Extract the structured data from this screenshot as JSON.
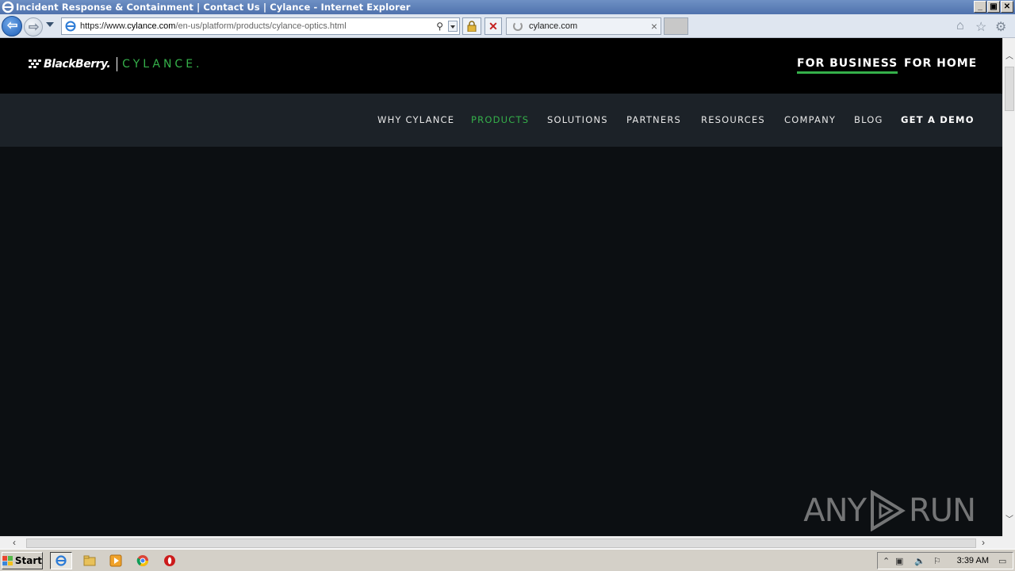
{
  "window": {
    "title": "Incident Response & Containment | Contact Us | Cylance - Internet Explorer",
    "controls": [
      "_",
      "▣",
      "✕"
    ]
  },
  "browser": {
    "url_prefix": "https://www.",
    "url_domain": "cylance.com",
    "url_path": "/en-us/platform/products/cylance-optics.html",
    "tab_title": "cylance.com",
    "icons": [
      "back-icon",
      "forward-icon",
      "search-icon",
      "lock-icon",
      "stop-icon",
      "home-icon",
      "favorites-star-icon",
      "tools-gear-icon"
    ]
  },
  "site": {
    "logo_blackberry": "BlackBerry.",
    "logo_cylance": "CYLANCE.",
    "segments": {
      "business": "FOR BUSINESS",
      "home": "FOR HOME"
    },
    "nav": {
      "why": "WHY CYLANCE",
      "products": "PRODUCTS",
      "solutions": "SOLUTIONS",
      "partners": "PARTNERS",
      "resources": "RESOURCES",
      "company": "COMPANY",
      "blog": "BLOG",
      "demo": "GET A DEMO"
    },
    "colors": {
      "accent": "#35b04a",
      "header": "#000000",
      "nav_bg": "#1c2228",
      "hero_bg": "#0c0f12"
    }
  },
  "watermark": {
    "left": "ANY",
    "right": "RUN"
  },
  "taskbar": {
    "start": "Start",
    "clock": "3:39 AM",
    "apps": [
      "internet-explorer-icon",
      "folder-icon",
      "media-player-icon",
      "chrome-icon",
      "opera-icon"
    ]
  }
}
